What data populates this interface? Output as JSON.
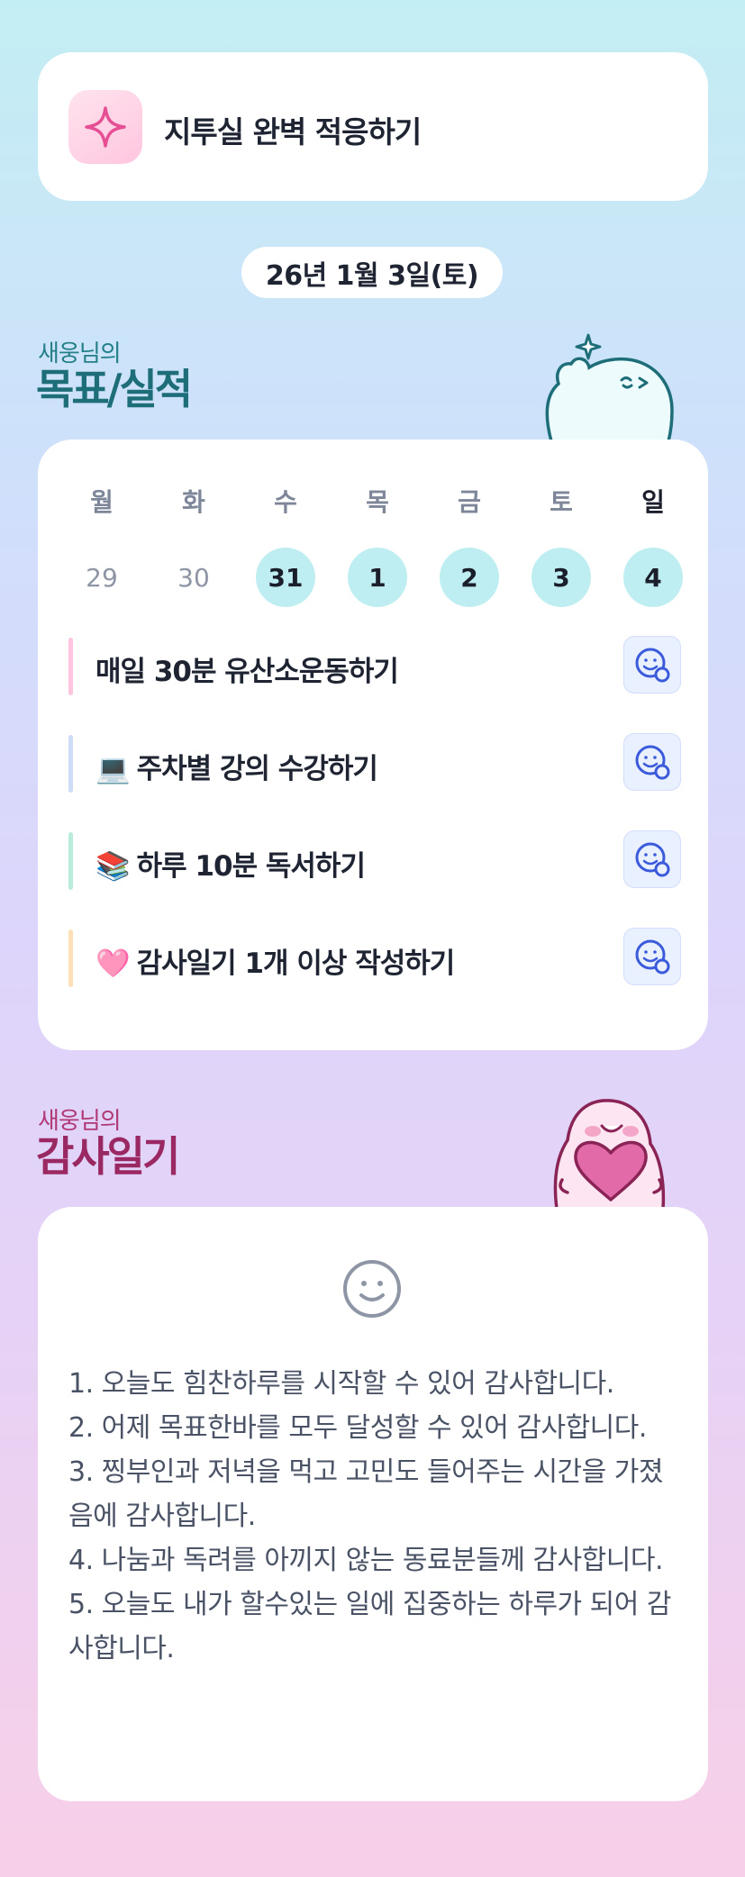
{
  "banner": {
    "title": "지투실 완벽 적응하기",
    "icon": "sparkle-icon"
  },
  "date": "26년 1월 3일(토)",
  "goals_section": {
    "subtitle": "새웅님의",
    "title": "목표/실적"
  },
  "week": {
    "days": [
      {
        "name": "월",
        "num": "29",
        "active": false
      },
      {
        "name": "화",
        "num": "30",
        "active": false
      },
      {
        "name": "수",
        "num": "31",
        "active": true
      },
      {
        "name": "목",
        "num": "1",
        "active": true
      },
      {
        "name": "금",
        "num": "2",
        "active": true
      },
      {
        "name": "토",
        "num": "3",
        "active": true
      },
      {
        "name": "일",
        "num": "4",
        "active": true
      }
    ]
  },
  "goals": [
    {
      "emoji": "",
      "text": "매일 30분 유산소운동하기",
      "bar_color": "#ffc4e0"
    },
    {
      "emoji": "💻",
      "text": "주차별 강의 수강하기",
      "bar_color": "#cfdcf7"
    },
    {
      "emoji": "📚",
      "text": "하루 10분 독서하기",
      "bar_color": "#b9ecd9"
    },
    {
      "emoji": "🩷",
      "text": "감사일기 1개 이상 작성하기",
      "bar_color": "#fde0b8"
    }
  ],
  "diary_section": {
    "subtitle": "새웅님의",
    "title": "감사일기"
  },
  "diary_lines": [
    "1. 오늘도 힘찬하루를 시작할 수 있어 감사합니다.",
    "2. 어제 목표한바를 모두 달성할 수 있어 감사합니다.",
    "3. 찡부인과 저녁을 먹고 고민도 들어주는 시간을 가졌음에 감사합니다.",
    "4. 나눔과 독려를 아끼지 않는 동료분들께 감사합니다.",
    "5. 오늘도 내가 할수있는 일에 집중하는 하루가 되어 감사합니다."
  ],
  "colors": {
    "accent_teal": "#1d6e79",
    "accent_pink": "#9a2862",
    "day_active_bg": "#bfeef2"
  }
}
